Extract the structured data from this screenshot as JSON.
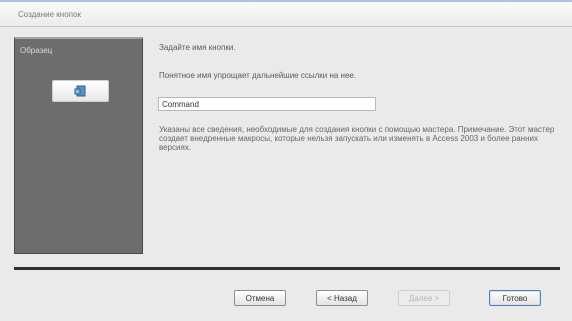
{
  "window": {
    "title": "Создание кнопок"
  },
  "sidebar": {
    "label": "Образец"
  },
  "main": {
    "prompt": "Задайте имя кнопки.",
    "hint": "Понятное имя упрощает дальнейшие ссылки на нее.",
    "name_value": "Command",
    "description": "Указаны все сведения, необходимые для создания кнопки с помощью мастера. Примечание. Этот мастер создает внедренные макросы, которые нельзя запускать или изменять в Access 2003 и более ранних версиях."
  },
  "buttons": {
    "cancel": "Отмена",
    "back": "< Назад",
    "next": "Далее >",
    "finish": "Готово"
  },
  "colors": {
    "panel": "#6d6d6d",
    "accent": "#5b7fae"
  }
}
